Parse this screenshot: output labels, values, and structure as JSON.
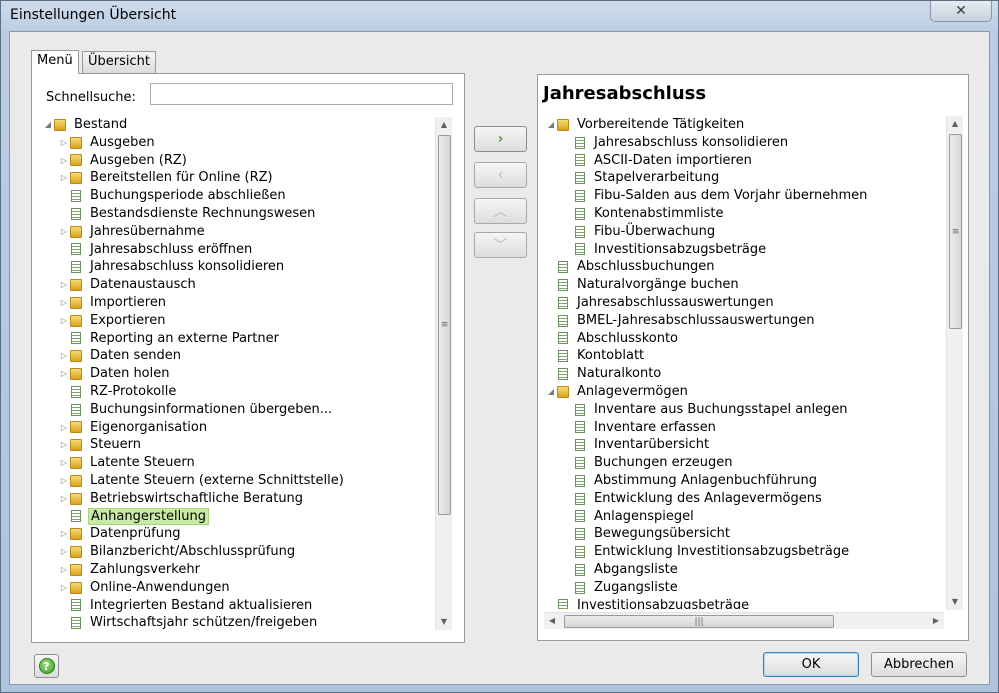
{
  "window": {
    "title": "Einstellungen Übersicht",
    "close_glyph": "✕"
  },
  "tabs": [
    {
      "label": "Menü",
      "active": true
    },
    {
      "label": "Übersicht",
      "active": false
    }
  ],
  "search": {
    "label": "Schnellsuche:",
    "value": "",
    "placeholder": ""
  },
  "left_tree": [
    {
      "label": "Bestand",
      "type": "folder",
      "level": 0,
      "expanded": true
    },
    {
      "label": "Ausgeben",
      "type": "folder",
      "level": 1,
      "expanded": false
    },
    {
      "label": "Ausgeben (RZ)",
      "type": "folder",
      "level": 1,
      "expanded": false
    },
    {
      "label": "Bereitstellen für Online (RZ)",
      "type": "folder",
      "level": 1,
      "expanded": false
    },
    {
      "label": "Buchungsperiode abschließen",
      "type": "doc",
      "level": 1
    },
    {
      "label": "Bestandsdienste Rechnungswesen",
      "type": "doc",
      "level": 1
    },
    {
      "label": "Jahresübernahme",
      "type": "folder",
      "level": 1,
      "expanded": false
    },
    {
      "label": "Jahresabschluss eröffnen",
      "type": "doc",
      "level": 1
    },
    {
      "label": "Jahresabschluss konsolidieren",
      "type": "doc",
      "level": 1
    },
    {
      "label": "Datenaustausch",
      "type": "folder",
      "level": 1,
      "expanded": false
    },
    {
      "label": "Importieren",
      "type": "folder",
      "level": 1,
      "expanded": false
    },
    {
      "label": "Exportieren",
      "type": "folder",
      "level": 1,
      "expanded": false
    },
    {
      "label": "Reporting an externe Partner",
      "type": "doc",
      "level": 1
    },
    {
      "label": "Daten senden",
      "type": "folder",
      "level": 1,
      "expanded": false
    },
    {
      "label": "Daten holen",
      "type": "folder",
      "level": 1,
      "expanded": false
    },
    {
      "label": "RZ-Protokolle",
      "type": "doc",
      "level": 1
    },
    {
      "label": "Buchungsinformationen übergeben...",
      "type": "doc",
      "level": 1
    },
    {
      "label": "Eigenorganisation",
      "type": "folder",
      "level": 1,
      "expanded": false
    },
    {
      "label": "Steuern",
      "type": "folder",
      "level": 1,
      "expanded": false
    },
    {
      "label": "Latente Steuern",
      "type": "folder",
      "level": 1,
      "expanded": false
    },
    {
      "label": "Latente Steuern (externe Schnittstelle)",
      "type": "folder",
      "level": 1,
      "expanded": false
    },
    {
      "label": "Betriebswirtschaftliche Beratung",
      "type": "folder",
      "level": 1,
      "expanded": false
    },
    {
      "label": "Anhangerstellung",
      "type": "doc",
      "level": 1,
      "selected": true
    },
    {
      "label": "Datenprüfung",
      "type": "folder",
      "level": 1,
      "expanded": false
    },
    {
      "label": "Bilanzbericht/Abschlussprüfung",
      "type": "folder",
      "level": 1,
      "expanded": false
    },
    {
      "label": "Zahlungsverkehr",
      "type": "folder",
      "level": 1,
      "expanded": false
    },
    {
      "label": "Online-Anwendungen",
      "type": "folder",
      "level": 1,
      "expanded": false
    },
    {
      "label": "Integrierten Bestand aktualisieren",
      "type": "doc",
      "level": 1
    },
    {
      "label": "Wirtschaftsjahr schützen/freigeben",
      "type": "doc",
      "level": 1
    }
  ],
  "move_buttons": [
    {
      "glyph": "›",
      "enabled": true
    },
    {
      "glyph": "‹",
      "enabled": false
    },
    {
      "glyph": "︿",
      "enabled": false
    },
    {
      "glyph": "﹀",
      "enabled": false
    }
  ],
  "right_panel": {
    "title": "Jahresabschluss",
    "tree": [
      {
        "label": "Vorbereitende Tätigkeiten",
        "type": "folder",
        "level": 0,
        "expanded": true
      },
      {
        "label": "Jahresabschluss konsolidieren",
        "type": "doc",
        "level": 1
      },
      {
        "label": "ASCII-Daten importieren",
        "type": "doc",
        "level": 1
      },
      {
        "label": "Stapelverarbeitung",
        "type": "doc",
        "level": 1
      },
      {
        "label": "Fibu-Salden aus dem Vorjahr übernehmen",
        "type": "doc",
        "level": 1
      },
      {
        "label": "Kontenabstimmliste",
        "type": "doc",
        "level": 1
      },
      {
        "label": "Fibu-Überwachung",
        "type": "doc",
        "level": 1
      },
      {
        "label": "Investitionsabzugsbeträge",
        "type": "doc",
        "level": 1
      },
      {
        "label": "Abschlussbuchungen",
        "type": "doc",
        "level": 0
      },
      {
        "label": "Naturalvorgänge buchen",
        "type": "doc",
        "level": 0
      },
      {
        "label": "Jahresabschlussauswertungen",
        "type": "doc",
        "level": 0
      },
      {
        "label": "BMEL-Jahresabschlussauswertungen",
        "type": "doc",
        "level": 0
      },
      {
        "label": "Abschlusskonto",
        "type": "doc",
        "level": 0
      },
      {
        "label": "Kontoblatt",
        "type": "doc",
        "level": 0
      },
      {
        "label": "Naturalkonto",
        "type": "doc",
        "level": 0
      },
      {
        "label": "Anlagevermögen",
        "type": "folder",
        "level": 0,
        "expanded": true
      },
      {
        "label": "Inventare aus Buchungsstapel anlegen",
        "type": "doc",
        "level": 1
      },
      {
        "label": "Inventare erfassen",
        "type": "doc",
        "level": 1
      },
      {
        "label": "Inventarübersicht",
        "type": "doc",
        "level": 1
      },
      {
        "label": "Buchungen erzeugen",
        "type": "doc",
        "level": 1
      },
      {
        "label": "Abstimmung Anlagenbuchführung",
        "type": "doc",
        "level": 1
      },
      {
        "label": "Entwicklung des Anlagevermögens",
        "type": "doc",
        "level": 1
      },
      {
        "label": "Anlagenspiegel",
        "type": "doc",
        "level": 1
      },
      {
        "label": "Bewegungsübersicht",
        "type": "doc",
        "level": 1
      },
      {
        "label": "Entwicklung Investitionsabzugsbeträge",
        "type": "doc",
        "level": 1
      },
      {
        "label": "Abgangsliste",
        "type": "doc",
        "level": 1
      },
      {
        "label": "Zugangsliste",
        "type": "doc",
        "level": 1
      },
      {
        "label": "Investitionsabzugsbeträge",
        "type": "doc",
        "level": 0
      }
    ]
  },
  "footer": {
    "help_glyph": "?",
    "ok_label": "OK",
    "cancel_label": "Abbrechen"
  },
  "colors": {
    "selection": "#c9eaa4",
    "folder": "#e3b232",
    "enabled_arrow": "#3a9a2a"
  }
}
